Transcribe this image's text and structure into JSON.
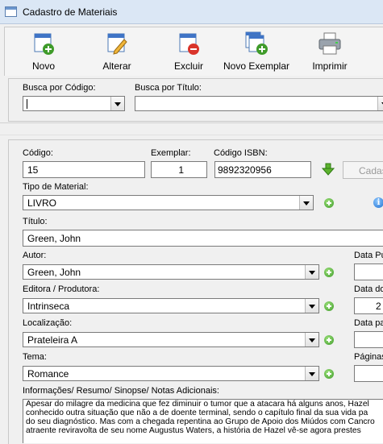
{
  "window": {
    "title": "Cadastro de Materiais"
  },
  "toolbar": {
    "novo": "Novo",
    "alterar": "Alterar",
    "excluir": "Excluir",
    "novo_exemplar": "Novo Exemplar",
    "imprimir": "Imprimir"
  },
  "search": {
    "by_code_label": "Busca por Código:",
    "by_code_value": "",
    "by_title_label": "Busca por Título:",
    "by_title_value": ""
  },
  "form": {
    "codigo_label": "Código:",
    "codigo_value": "15",
    "exemplar_label": "Exemplar:",
    "exemplar_value": "1",
    "isbn_label": "Código ISBN:",
    "isbn_value": "9892320956",
    "search_isbn_button": "Cadas",
    "tipo_label": "Tipo de Material:",
    "tipo_value": "LIVRO",
    "titulo_label": "Título:",
    "titulo_value": "Green, John",
    "autor_label": "Autor:",
    "autor_value": "Green, John",
    "editora_label": "Editora / Produtora:",
    "editora_value": "Intrinseca",
    "localizacao_label": "Localização:",
    "localizacao_value": "Prateleira A",
    "tema_label": "Tema:",
    "tema_value": "Romance",
    "data_pub_label": "Data Pu",
    "data_do_label": "Data do",
    "data_do_value": "2",
    "data_pa_label": "Data pa",
    "paginas_label": "Páginas",
    "info_label": "Informações/ Resumo/ Sinopse/ Notas Adicionais:",
    "info_lines": [
      "Apesar do milagre da medicina que fez diminuir o tumor que a atacara há alguns anos, Hazel",
      "conhecido outra situação que não a de doente terminal, sendo o capítulo final da sua vida pa",
      "do seu diagnóstico. Mas com a chegada repentina ao Grupo de Apoio dos Miúdos com Cancro",
      "atraente reviravolta de seu nome Augustus Waters, a história de Hazel vê-se agora prestes"
    ]
  },
  "colors": {
    "accent": "#1f6fd1",
    "add": "#3f9b2a",
    "delete": "#d9342b"
  }
}
